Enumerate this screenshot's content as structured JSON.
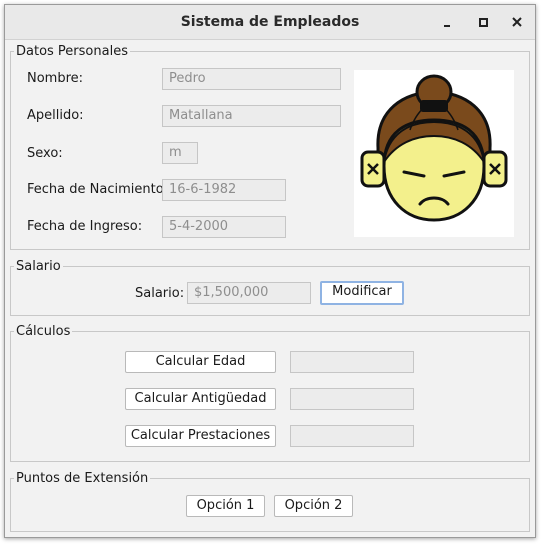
{
  "window": {
    "title": "Sistema de Empleados",
    "controls": [
      "minimize-icon",
      "maximize-icon",
      "close-icon"
    ]
  },
  "personal": {
    "legend": "Datos Personales",
    "nombre_label": "Nombre:",
    "nombre_value": "Pedro",
    "apellido_label": "Apellido:",
    "apellido_value": "Matallana",
    "sexo_label": "Sexo:",
    "sexo_value": "m",
    "nacimiento_label": "Fecha de Nacimiento:",
    "nacimiento_value": "16-6-1982",
    "ingreso_label": "Fecha de Ingreso:",
    "ingreso_value": "5-4-2000",
    "photo_icon": "employee-face-icon"
  },
  "salario": {
    "legend": "Salario",
    "label": "Salario:",
    "value": "$1,500,000",
    "modify_button": "Modificar"
  },
  "calculos": {
    "legend": "Cálculos",
    "edad_button": "Calcular Edad",
    "edad_result": "",
    "antiguedad_button": "Calcular Antigüedad",
    "antiguedad_result": "",
    "prestaciones_button": "Calcular Prestaciones",
    "prestaciones_result": ""
  },
  "extension": {
    "legend": "Puntos de Extensión",
    "option1_button": "Opción 1",
    "option2_button": "Opción 2"
  },
  "colors": {
    "window_bg": "#f2f2f2",
    "field_bg": "#ececec",
    "field_text": "#8e8e8e",
    "focus_border": "#8fb3e3",
    "face_yellow": "#f3f08c",
    "hair_brown": "#7a4a1c"
  }
}
